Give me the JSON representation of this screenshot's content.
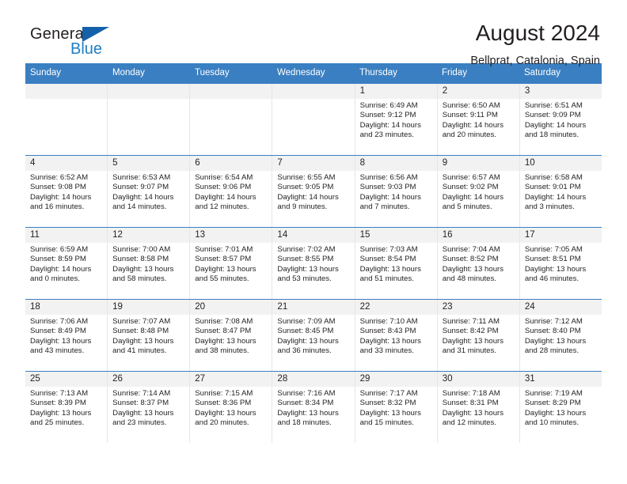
{
  "brand": {
    "general": "General",
    "blue": "Blue",
    "triangle_color": "#1561a9",
    "blue_color": "#1f7ec2"
  },
  "header": {
    "title": "August 2024",
    "subtitle": "Bellprat, Catalonia, Spain"
  },
  "calendar": {
    "header_bg": "#3a7fc1",
    "daynames": [
      "Sunday",
      "Monday",
      "Tuesday",
      "Wednesday",
      "Thursday",
      "Friday",
      "Saturday"
    ],
    "weeks": [
      [
        {
          "day": "",
          "lines": []
        },
        {
          "day": "",
          "lines": []
        },
        {
          "day": "",
          "lines": []
        },
        {
          "day": "",
          "lines": []
        },
        {
          "day": "1",
          "lines": [
            "Sunrise: 6:49 AM",
            "Sunset: 9:12 PM",
            "Daylight: 14 hours",
            "and 23 minutes."
          ]
        },
        {
          "day": "2",
          "lines": [
            "Sunrise: 6:50 AM",
            "Sunset: 9:11 PM",
            "Daylight: 14 hours",
            "and 20 minutes."
          ]
        },
        {
          "day": "3",
          "lines": [
            "Sunrise: 6:51 AM",
            "Sunset: 9:09 PM",
            "Daylight: 14 hours",
            "and 18 minutes."
          ]
        }
      ],
      [
        {
          "day": "4",
          "lines": [
            "Sunrise: 6:52 AM",
            "Sunset: 9:08 PM",
            "Daylight: 14 hours",
            "and 16 minutes."
          ]
        },
        {
          "day": "5",
          "lines": [
            "Sunrise: 6:53 AM",
            "Sunset: 9:07 PM",
            "Daylight: 14 hours",
            "and 14 minutes."
          ]
        },
        {
          "day": "6",
          "lines": [
            "Sunrise: 6:54 AM",
            "Sunset: 9:06 PM",
            "Daylight: 14 hours",
            "and 12 minutes."
          ]
        },
        {
          "day": "7",
          "lines": [
            "Sunrise: 6:55 AM",
            "Sunset: 9:05 PM",
            "Daylight: 14 hours",
            "and 9 minutes."
          ]
        },
        {
          "day": "8",
          "lines": [
            "Sunrise: 6:56 AM",
            "Sunset: 9:03 PM",
            "Daylight: 14 hours",
            "and 7 minutes."
          ]
        },
        {
          "day": "9",
          "lines": [
            "Sunrise: 6:57 AM",
            "Sunset: 9:02 PM",
            "Daylight: 14 hours",
            "and 5 minutes."
          ]
        },
        {
          "day": "10",
          "lines": [
            "Sunrise: 6:58 AM",
            "Sunset: 9:01 PM",
            "Daylight: 14 hours",
            "and 3 minutes."
          ]
        }
      ],
      [
        {
          "day": "11",
          "lines": [
            "Sunrise: 6:59 AM",
            "Sunset: 8:59 PM",
            "Daylight: 14 hours",
            "and 0 minutes."
          ]
        },
        {
          "day": "12",
          "lines": [
            "Sunrise: 7:00 AM",
            "Sunset: 8:58 PM",
            "Daylight: 13 hours",
            "and 58 minutes."
          ]
        },
        {
          "day": "13",
          "lines": [
            "Sunrise: 7:01 AM",
            "Sunset: 8:57 PM",
            "Daylight: 13 hours",
            "and 55 minutes."
          ]
        },
        {
          "day": "14",
          "lines": [
            "Sunrise: 7:02 AM",
            "Sunset: 8:55 PM",
            "Daylight: 13 hours",
            "and 53 minutes."
          ]
        },
        {
          "day": "15",
          "lines": [
            "Sunrise: 7:03 AM",
            "Sunset: 8:54 PM",
            "Daylight: 13 hours",
            "and 51 minutes."
          ]
        },
        {
          "day": "16",
          "lines": [
            "Sunrise: 7:04 AM",
            "Sunset: 8:52 PM",
            "Daylight: 13 hours",
            "and 48 minutes."
          ]
        },
        {
          "day": "17",
          "lines": [
            "Sunrise: 7:05 AM",
            "Sunset: 8:51 PM",
            "Daylight: 13 hours",
            "and 46 minutes."
          ]
        }
      ],
      [
        {
          "day": "18",
          "lines": [
            "Sunrise: 7:06 AM",
            "Sunset: 8:49 PM",
            "Daylight: 13 hours",
            "and 43 minutes."
          ]
        },
        {
          "day": "19",
          "lines": [
            "Sunrise: 7:07 AM",
            "Sunset: 8:48 PM",
            "Daylight: 13 hours",
            "and 41 minutes."
          ]
        },
        {
          "day": "20",
          "lines": [
            "Sunrise: 7:08 AM",
            "Sunset: 8:47 PM",
            "Daylight: 13 hours",
            "and 38 minutes."
          ]
        },
        {
          "day": "21",
          "lines": [
            "Sunrise: 7:09 AM",
            "Sunset: 8:45 PM",
            "Daylight: 13 hours",
            "and 36 minutes."
          ]
        },
        {
          "day": "22",
          "lines": [
            "Sunrise: 7:10 AM",
            "Sunset: 8:43 PM",
            "Daylight: 13 hours",
            "and 33 minutes."
          ]
        },
        {
          "day": "23",
          "lines": [
            "Sunrise: 7:11 AM",
            "Sunset: 8:42 PM",
            "Daylight: 13 hours",
            "and 31 minutes."
          ]
        },
        {
          "day": "24",
          "lines": [
            "Sunrise: 7:12 AM",
            "Sunset: 8:40 PM",
            "Daylight: 13 hours",
            "and 28 minutes."
          ]
        }
      ],
      [
        {
          "day": "25",
          "lines": [
            "Sunrise: 7:13 AM",
            "Sunset: 8:39 PM",
            "Daylight: 13 hours",
            "and 25 minutes."
          ]
        },
        {
          "day": "26",
          "lines": [
            "Sunrise: 7:14 AM",
            "Sunset: 8:37 PM",
            "Daylight: 13 hours",
            "and 23 minutes."
          ]
        },
        {
          "day": "27",
          "lines": [
            "Sunrise: 7:15 AM",
            "Sunset: 8:36 PM",
            "Daylight: 13 hours",
            "and 20 minutes."
          ]
        },
        {
          "day": "28",
          "lines": [
            "Sunrise: 7:16 AM",
            "Sunset: 8:34 PM",
            "Daylight: 13 hours",
            "and 18 minutes."
          ]
        },
        {
          "day": "29",
          "lines": [
            "Sunrise: 7:17 AM",
            "Sunset: 8:32 PM",
            "Daylight: 13 hours",
            "and 15 minutes."
          ]
        },
        {
          "day": "30",
          "lines": [
            "Sunrise: 7:18 AM",
            "Sunset: 8:31 PM",
            "Daylight: 13 hours",
            "and 12 minutes."
          ]
        },
        {
          "day": "31",
          "lines": [
            "Sunrise: 7:19 AM",
            "Sunset: 8:29 PM",
            "Daylight: 13 hours",
            "and 10 minutes."
          ]
        }
      ]
    ]
  }
}
